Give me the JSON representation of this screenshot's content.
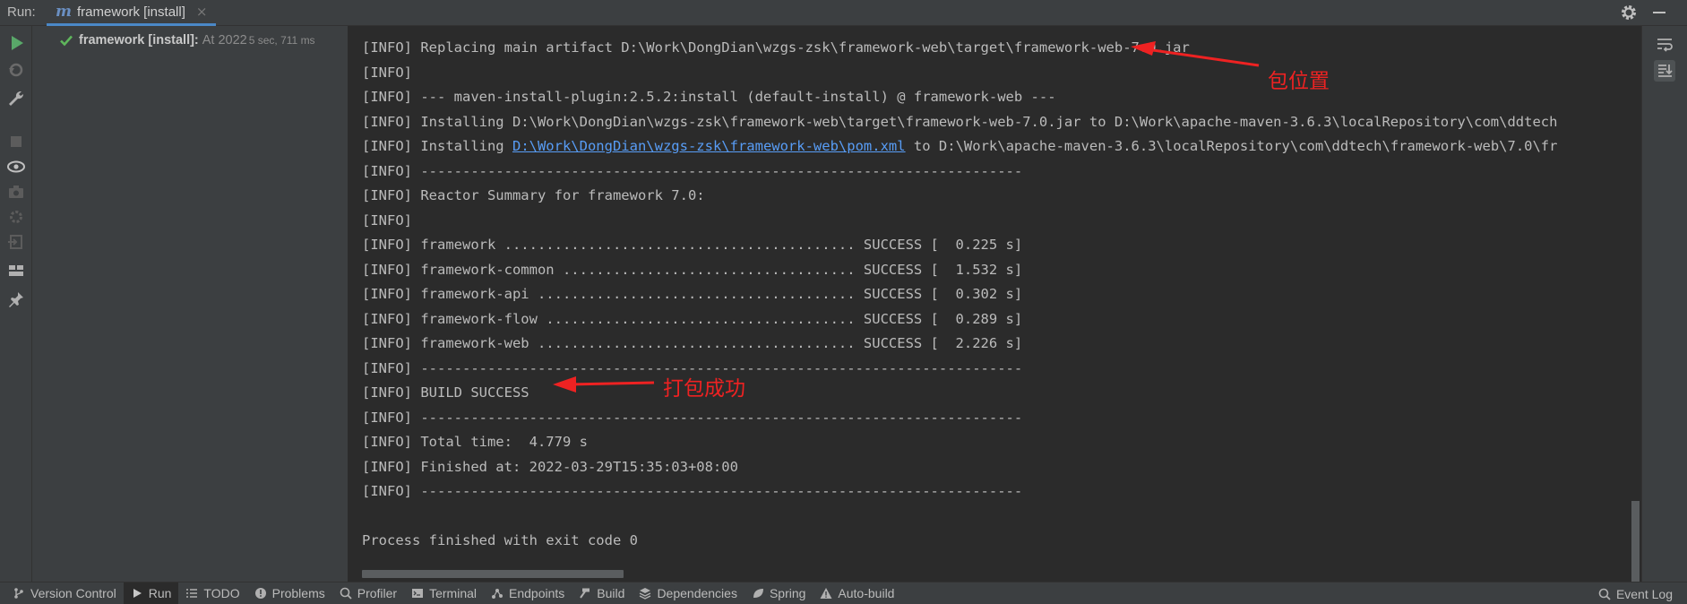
{
  "header": {
    "run_label": "Run:",
    "tab": {
      "label": "framework [install]",
      "close": "×"
    }
  },
  "tree": {
    "name": "framework [install]:",
    "time": "At 2022",
    "duration": "5 sec, 711 ms"
  },
  "console": {
    "lines": [
      "[INFO] Replacing main artifact D:\\Work\\DongDian\\wzgs-zsk\\framework-web\\target\\framework-web-7.0.jar",
      "[INFO]",
      "[INFO] --- maven-install-plugin:2.5.2:install (default-install) @ framework-web ---",
      "[INFO] Installing D:\\Work\\DongDian\\wzgs-zsk\\framework-web\\target\\framework-web-7.0.jar to D:\\Work\\apache-maven-3.6.3\\localRepository\\com\\ddtech",
      {
        "pre": "[INFO] Installing ",
        "link": "D:\\Work\\DongDian\\wzgs-zsk\\framework-web\\pom.xml",
        "post": " to D:\\Work\\apache-maven-3.6.3\\localRepository\\com\\ddtech\\framework-web\\7.0\\fr"
      },
      "[INFO] ------------------------------------------------------------------------",
      "[INFO] Reactor Summary for framework 7.0:",
      "[INFO]",
      "[INFO] framework .......................................... SUCCESS [  0.225 s]",
      "[INFO] framework-common ................................... SUCCESS [  1.532 s]",
      "[INFO] framework-api ...................................... SUCCESS [  0.302 s]",
      "[INFO] framework-flow ..................................... SUCCESS [  0.289 s]",
      "[INFO] framework-web ...................................... SUCCESS [  2.226 s]",
      "[INFO] ------------------------------------------------------------------------",
      "[INFO] BUILD SUCCESS",
      "[INFO] ------------------------------------------------------------------------",
      "[INFO] Total time:  4.779 s",
      "[INFO] Finished at: 2022-03-29T15:35:03+08:00",
      "[INFO] ------------------------------------------------------------------------",
      "",
      "Process finished with exit code 0"
    ]
  },
  "annotations": {
    "package_location": "包位置",
    "build_success": "打包成功"
  },
  "bottom_bar": {
    "items": [
      {
        "label": "Version Control",
        "icon": "branch-icon"
      },
      {
        "label": "Run",
        "icon": "run-icon"
      },
      {
        "label": "TODO",
        "icon": "list-icon"
      },
      {
        "label": "Problems",
        "icon": "warning-icon"
      },
      {
        "label": "Profiler",
        "icon": "profiler-icon"
      },
      {
        "label": "Terminal",
        "icon": "terminal-icon"
      },
      {
        "label": "Endpoints",
        "icon": "endpoints-icon"
      },
      {
        "label": "Build",
        "icon": "hammer-icon"
      },
      {
        "label": "Dependencies",
        "icon": "layers-icon"
      },
      {
        "label": "Spring",
        "icon": "leaf-icon"
      },
      {
        "label": "Auto-build",
        "icon": "triangle-warning-icon"
      }
    ],
    "event_log": "Event Log"
  },
  "colors": {
    "accent": "#4a88c7",
    "success": "#5fb65c",
    "link": "#589df6",
    "annotation": "#ee2222"
  }
}
